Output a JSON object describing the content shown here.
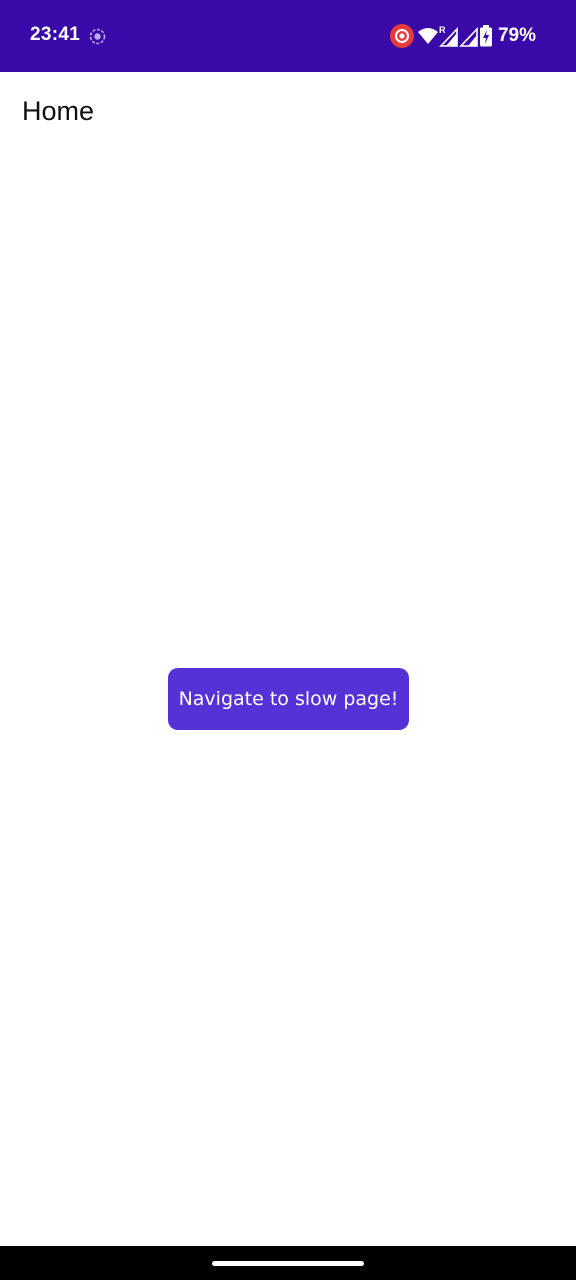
{
  "status_bar": {
    "time": "23:41",
    "battery": "79%",
    "icons": [
      "sync-icon",
      "screen-record-icon",
      "wifi-icon",
      "signal-roaming-icon",
      "signal-icon",
      "battery-charging-icon"
    ],
    "background": "#3a0aa8"
  },
  "header": {
    "title": "Home"
  },
  "main": {
    "button_label": "Navigate to slow page!",
    "button_color": "#5531d6"
  }
}
